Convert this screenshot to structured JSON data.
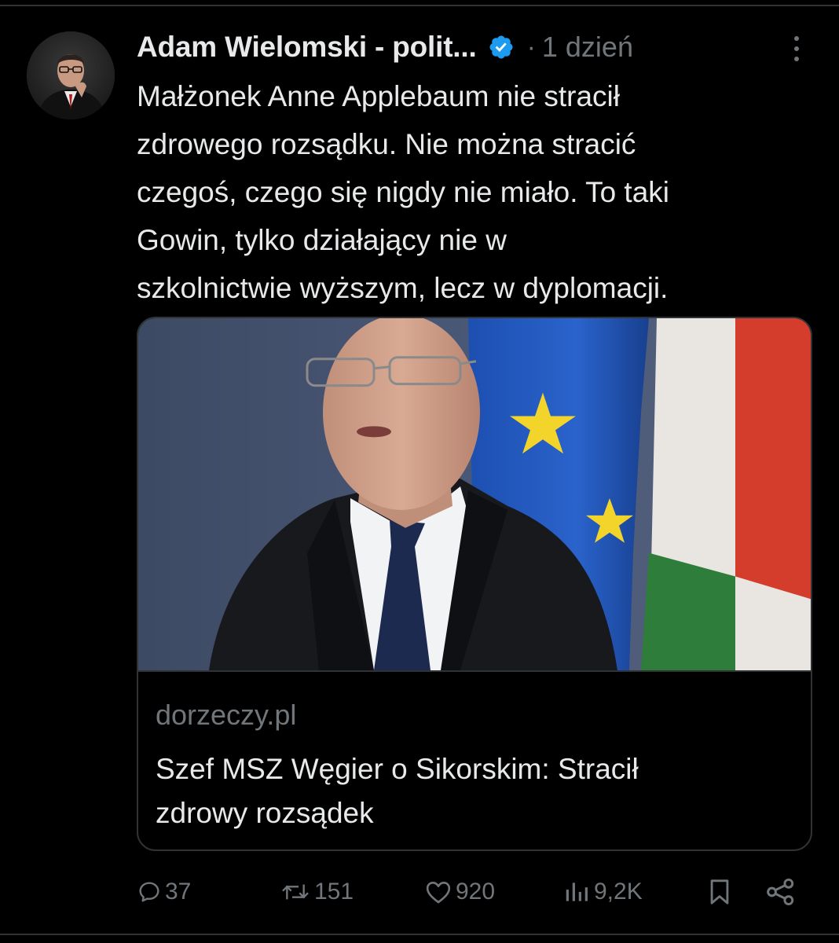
{
  "tweet": {
    "author_name": "Adam Wielomski - polit...",
    "separator": "·",
    "time": "1 dzień",
    "text_lines": [
      "Małżonek Anne Applebaum nie stracił",
      "zdrowego rozsądku. Nie można stracić",
      "czegoś, czego się nigdy nie miało. To taki",
      "Gowin, tylko działający nie w",
      "szkolnictwie wyższym, lecz w dyplomacji."
    ]
  },
  "card": {
    "domain": "dorzeczy.pl",
    "title_lines": [
      "Szef MSZ Węgier o Sikorskim: Stracił",
      "zdrowy rozsądek"
    ]
  },
  "actions": {
    "replies": "37",
    "reposts": "151",
    "likes": "920",
    "views": "9,2K"
  },
  "icons": {
    "avatar": "avatar",
    "verified": "verified-badge-icon",
    "more": "more-dots-icon",
    "reply": "reply-icon",
    "repost": "repost-icon",
    "like": "heart-icon",
    "views": "views-chart-icon",
    "bookmark": "bookmark-icon",
    "share": "share-icon"
  },
  "colors": {
    "background": "#000000",
    "text": "#e7e9ea",
    "secondary": "#71767b",
    "border": "#2f3336",
    "verified": "#1d9bf0"
  }
}
